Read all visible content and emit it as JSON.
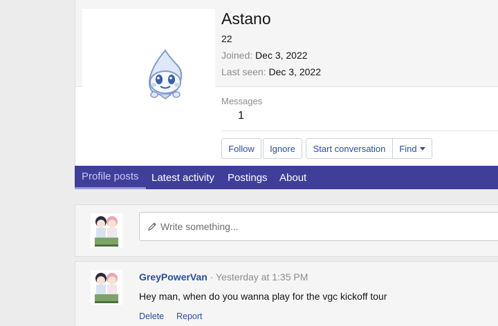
{
  "profile": {
    "name": "Astano",
    "title": "22",
    "joined_label": "Joined:",
    "joined_value": "Dec 3, 2022",
    "last_seen_label": "Last seen:",
    "last_seen_value": "Dec 3, 2022",
    "messages_label": "Messages",
    "messages_value": "1"
  },
  "actions": {
    "follow": "Follow",
    "ignore": "Ignore",
    "start_conversation": "Start conversation",
    "find": "Find"
  },
  "tabs": [
    {
      "label": "Profile posts"
    },
    {
      "label": "Latest activity"
    },
    {
      "label": "Postings"
    },
    {
      "label": "About"
    }
  ],
  "composer": {
    "placeholder": "Write something..."
  },
  "post": {
    "author": "GreyPowerVan",
    "separator": "·",
    "time": "Yesterday at 1:35 PM",
    "body": "Hey man, when do you wanna play for the vgc kickoff tour",
    "delete": "Delete",
    "report": "Report"
  },
  "colors": {
    "tab_bar": "#3f3f9a",
    "link": "#2b4d99",
    "muted": "#8c8c8c"
  }
}
